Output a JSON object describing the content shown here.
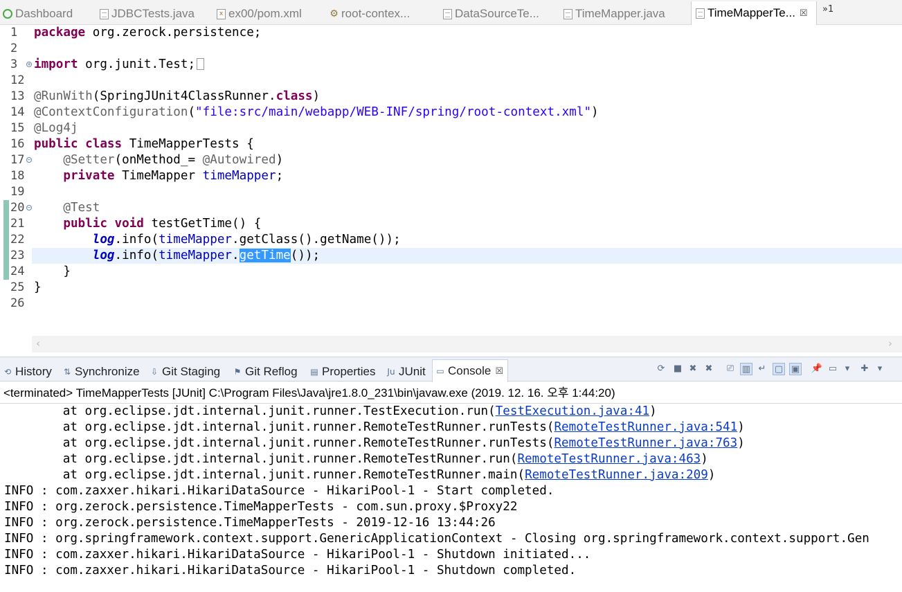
{
  "editor_tabs": [
    {
      "label": "Dashboard",
      "icon": "dashboard-icon"
    },
    {
      "label": "JDBCTests.java",
      "icon": "java-file-icon"
    },
    {
      "label": "ex00/pom.xml",
      "icon": "xml-file-icon"
    },
    {
      "label": "root-contex...",
      "icon": "spring-config-icon"
    },
    {
      "label": "DataSourceTe...",
      "icon": "java-file-icon"
    },
    {
      "label": "TimeMapper.java",
      "icon": "java-file-icon"
    },
    {
      "label": "TimeMapperTe...",
      "icon": "java-file-icon",
      "active": true,
      "close": "☒"
    }
  ],
  "tab_overflow": "»1",
  "editor": {
    "line_numbers": [
      "1",
      "2",
      "3",
      "12",
      "13",
      "14",
      "15",
      "16",
      "17",
      "18",
      "19",
      "20",
      "21",
      "22",
      "23",
      "24",
      "25",
      "26"
    ],
    "folds": {
      "3": "+",
      "17": "−",
      "20": "−"
    },
    "code": {
      "l1_kw": "package",
      "l1_rest": " org.zerock.persistence;",
      "l3_kw": "import",
      "l3_rest": " org.junit.Test;",
      "l13_ann": "@RunWith",
      "l13_rest": "(SpringJUnit4ClassRunner.",
      "l13_kw": "class",
      "l13_end": ")",
      "l14_ann": "@ContextConfiguration",
      "l14_open": "(",
      "l14_str": "\"file:src/main/webapp/WEB-INF/spring/root-context.xml\"",
      "l14_end": ")",
      "l15_ann": "@Log4j",
      "l16_kw1": "public",
      "l16_kw2": "class",
      "l16_rest": " TimeMapperTests {",
      "l17_ann": "@Setter",
      "l17_mid": "(onMethod_= ",
      "l17_ann2": "@Autowired",
      "l17_end": ")",
      "l18_kw": "private",
      "l18_type": " TimeMapper ",
      "l18_fld": "timeMapper",
      "l18_end": ";",
      "l20_ann": "@Test",
      "l21_kw1": "public",
      "l21_kw2": "void",
      "l21_rest": " testGetTime() {",
      "l22_log": "log",
      "l22_a": ".info(",
      "l22_fld": "timeMapper",
      "l22_b": ".getClass().getName());",
      "l23_log": "log",
      "l23_a": ".info(",
      "l23_fld": "timeMapper",
      "l23_dot": ".",
      "l23_sel": "getTime",
      "l23_end": "());",
      "l24": "}",
      "l25": "}"
    }
  },
  "views": {
    "tabs": [
      {
        "label": "History",
        "icon": "history-icon"
      },
      {
        "label": "Synchronize",
        "icon": "synchronize-icon"
      },
      {
        "label": "Git Staging",
        "icon": "git-staging-icon"
      },
      {
        "label": "Git Reflog",
        "icon": "git-reflog-icon"
      },
      {
        "label": "Properties",
        "icon": "properties-icon"
      },
      {
        "label": "JUnit",
        "icon": "junit-icon"
      },
      {
        "label": "Console",
        "icon": "console-icon",
        "active": true,
        "close": "☒"
      }
    ]
  },
  "console": {
    "description": "<terminated> TimeMapperTests [JUnit] C:\\Program Files\\Java\\jre1.8.0_231\\bin\\javaw.exe (2019. 12. 16. 오후 1:44:20)",
    "stack": [
      {
        "prefix": "\tat org.eclipse.jdt.internal.junit.runner.TestExecution.run(",
        "link": "TestExecution.java:41",
        "suffix": ")"
      },
      {
        "prefix": "\tat org.eclipse.jdt.internal.junit.runner.RemoteTestRunner.runTests(",
        "link": "RemoteTestRunner.java:541",
        "suffix": ")"
      },
      {
        "prefix": "\tat org.eclipse.jdt.internal.junit.runner.RemoteTestRunner.runTests(",
        "link": "RemoteTestRunner.java:763",
        "suffix": ")"
      },
      {
        "prefix": "\tat org.eclipse.jdt.internal.junit.runner.RemoteTestRunner.run(",
        "link": "RemoteTestRunner.java:463",
        "suffix": ")"
      },
      {
        "prefix": "\tat org.eclipse.jdt.internal.junit.runner.RemoteTestRunner.main(",
        "link": "RemoteTestRunner.java:209",
        "suffix": ")"
      }
    ],
    "log_lines": [
      "INFO : com.zaxxer.hikari.HikariDataSource - HikariPool-1 - Start completed.",
      "INFO : org.zerock.persistence.TimeMapperTests - com.sun.proxy.$Proxy22",
      "INFO : org.zerock.persistence.TimeMapperTests - 2019-12-16 13:44:26",
      "INFO : org.springframework.context.support.GenericApplicationContext - Closing org.springframework.context.support.Gen",
      "INFO : com.zaxxer.hikari.HikariDataSource - HikariPool-1 - Shutdown initiated...",
      "INFO : com.zaxxer.hikari.HikariDataSource - HikariPool-1 - Shutdown completed."
    ]
  },
  "colors": {
    "keyword": "#7f0055",
    "annotation": "#646464",
    "string": "#2a00ff",
    "field": "#0000c0",
    "selection": "#3399ff",
    "current_line": "#e8f2fe",
    "link": "#0a3cc8"
  }
}
